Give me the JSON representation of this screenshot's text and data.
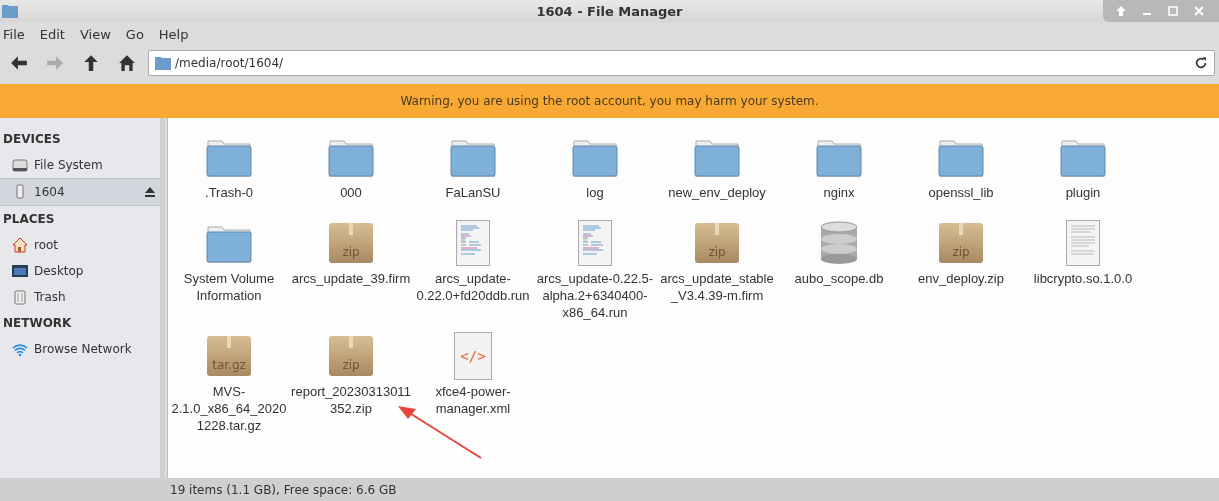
{
  "window": {
    "title": "1604 - File Manager"
  },
  "menu": [
    "File",
    "Edit",
    "View",
    "Go",
    "Help"
  ],
  "toolbar": [
    {
      "kind": "back",
      "disabled": false
    },
    {
      "kind": "forward",
      "disabled": true
    },
    {
      "kind": "up",
      "disabled": false
    },
    {
      "kind": "home",
      "disabled": false
    }
  ],
  "location": {
    "value": "/media/root/1604/"
  },
  "warning": "Warning, you are using the root account, you may harm your system.",
  "sidebar": [
    {
      "heading": "DEVICES",
      "items": [
        {
          "label": "File System",
          "kind": "drive",
          "selected": false
        },
        {
          "label": "1604",
          "kind": "usb",
          "selected": true,
          "eject": true
        }
      ]
    },
    {
      "heading": "PLACES",
      "items": [
        {
          "label": "root",
          "kind": "home",
          "selected": false
        },
        {
          "label": "Desktop",
          "kind": "desktop",
          "selected": false
        },
        {
          "label": "Trash",
          "kind": "trash",
          "selected": false
        }
      ]
    },
    {
      "heading": "NETWORK",
      "items": [
        {
          "label": "Browse Network",
          "kind": "network",
          "selected": false
        }
      ]
    }
  ],
  "files": [
    {
      "name": ".Trash-0",
      "kind": "folder"
    },
    {
      "name": "000",
      "kind": "folder"
    },
    {
      "name": "FaLanSU",
      "kind": "folder"
    },
    {
      "name": "log",
      "kind": "folder"
    },
    {
      "name": "new_env_deploy",
      "kind": "folder"
    },
    {
      "name": "nginx",
      "kind": "folder"
    },
    {
      "name": "openssl_lib",
      "kind": "folder"
    },
    {
      "name": "plugin",
      "kind": "folder"
    },
    {
      "name": "System Volume Information",
      "kind": "folder"
    },
    {
      "name": "arcs_update_39.firm",
      "kind": "archive",
      "badge": "zip"
    },
    {
      "name": "arcs_update-0.22.0+fd20ddb.run",
      "kind": "script"
    },
    {
      "name": "arcs_update-0.22.5-alpha.2+6340400-x86_64.run",
      "kind": "script"
    },
    {
      "name": "arcs_update_stable_V3.4.39-m.firm",
      "kind": "archive",
      "badge": "zip"
    },
    {
      "name": "aubo_scope.db",
      "kind": "database"
    },
    {
      "name": "env_deploy.zip",
      "kind": "archive",
      "badge": "zip"
    },
    {
      "name": "libcrypto.so.1.0.0",
      "kind": "text"
    },
    {
      "name": "MVS-2.1.0_x86_64_20201228.tar.gz",
      "kind": "archive",
      "badge": "tar.gz"
    },
    {
      "name": "report_20230313011352.zip",
      "kind": "archive",
      "badge": "zip"
    },
    {
      "name": "xfce4-power-manager.xml",
      "kind": "xml",
      "badge": "</>"
    }
  ],
  "status_bar": "19 items (1.1 GB), Free space: 6.6 GB"
}
